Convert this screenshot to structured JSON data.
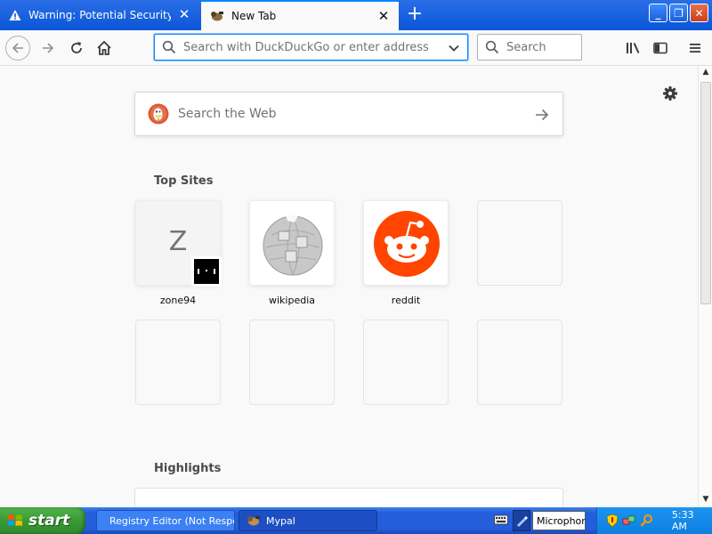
{
  "tabs": [
    {
      "title": "Warning: Potential Security Risk Ahead",
      "icon": "warning-icon",
      "active": false
    },
    {
      "title": "New Tab",
      "icon": "mypal-icon",
      "active": true
    }
  ],
  "new_tab_symbol": "+",
  "window_buttons": {
    "minimize": "_",
    "maximize": "❐",
    "close": "✕"
  },
  "navbar": {
    "url_placeholder": "Search with DuckDuckGo or enter address",
    "search_placeholder": "Search"
  },
  "newtab": {
    "web_search_placeholder": "Search the Web",
    "top_sites_title": "Top Sites",
    "highlights_title": "Highlights",
    "top_sites": [
      {
        "label": "zone94",
        "letter": "Z"
      },
      {
        "label": "wikipedia"
      },
      {
        "label": "reddit"
      }
    ]
  },
  "taskbar": {
    "start_label": "start",
    "tasks": [
      {
        "label": "Registry Editor (Not Responding)",
        "icon": "registry-icon"
      },
      {
        "label": "Mypal",
        "icon": "mypal-icon"
      }
    ],
    "mic_label": "Microphone",
    "clock": "5:33 AM"
  },
  "colors": {
    "accent": "#0a84ff",
    "titlebar": "#0a56d8",
    "reddit": "#ff4500",
    "ddg": "#de5833",
    "start_green": "#3a9a35"
  }
}
